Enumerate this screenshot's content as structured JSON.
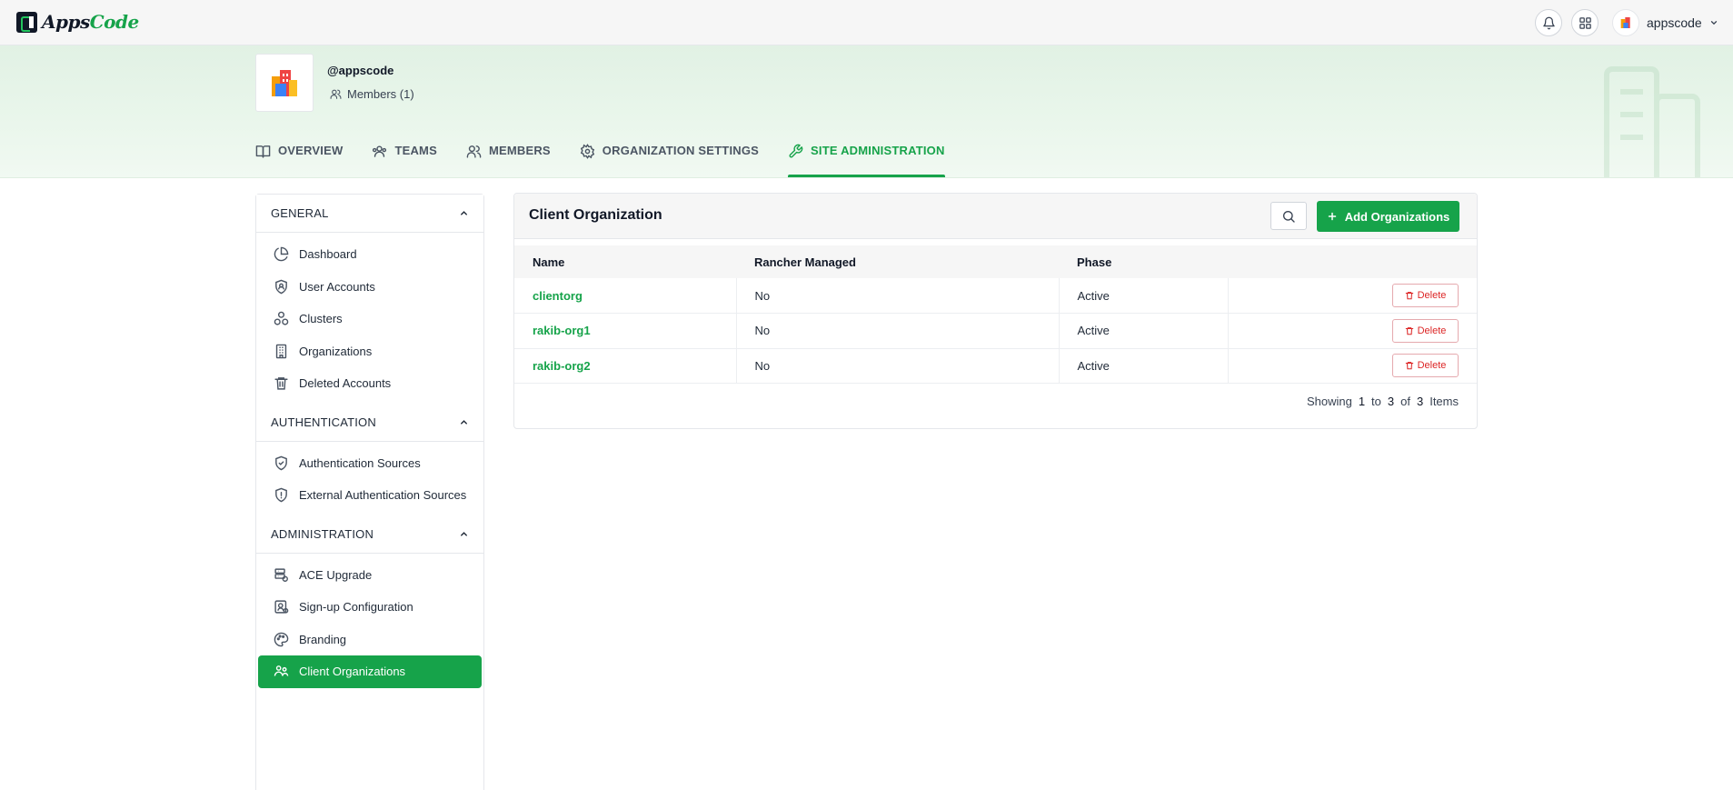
{
  "brand": {
    "name_part1": "Apps",
    "name_part2": "Code",
    "accent": "#16a34a"
  },
  "topbar": {
    "icons": [
      "bell-icon",
      "grid-apps-icon"
    ],
    "username": "appscode"
  },
  "org": {
    "handle": "@appscode",
    "members_label": "Members (1)"
  },
  "tabs": [
    {
      "label": "OVERVIEW",
      "icon": "book-icon",
      "active": false
    },
    {
      "label": "TEAMS",
      "icon": "team-icon",
      "active": false
    },
    {
      "label": "MEMBERS",
      "icon": "members-icon",
      "active": false
    },
    {
      "label": "ORGANIZATION SETTINGS",
      "icon": "gear-icon",
      "active": false
    },
    {
      "label": "SITE ADMINISTRATION",
      "icon": "wrench-icon",
      "active": true
    }
  ],
  "sidebar": {
    "sections": [
      {
        "title": "GENERAL",
        "items": [
          {
            "label": "Dashboard",
            "icon": "pie-chart-icon"
          },
          {
            "label": "User Accounts",
            "icon": "user-shield-icon"
          },
          {
            "label": "Clusters",
            "icon": "clusters-icon"
          },
          {
            "label": "Organizations",
            "icon": "building-icon"
          },
          {
            "label": "Deleted Accounts",
            "icon": "trash-icon"
          }
        ]
      },
      {
        "title": "AUTHENTICATION",
        "items": [
          {
            "label": "Authentication Sources",
            "icon": "shield-check-icon"
          },
          {
            "label": "External Authentication Sources",
            "icon": "shield-alert-icon"
          }
        ]
      },
      {
        "title": "ADMINISTRATION",
        "items": [
          {
            "label": "ACE Upgrade",
            "icon": "server-upgrade-icon"
          },
          {
            "label": "Sign-up Configuration",
            "icon": "signup-config-icon"
          },
          {
            "label": "Branding",
            "icon": "palette-icon"
          },
          {
            "label": "Client Organizations",
            "icon": "client-org-icon",
            "active": true
          }
        ]
      }
    ]
  },
  "main": {
    "title": "Client Organization",
    "add_button": "Add Organizations",
    "columns": [
      "Name",
      "Rancher Managed",
      "Phase",
      ""
    ],
    "rows": [
      {
        "name": "clientorg",
        "rancher_managed": "No",
        "phase": "Active",
        "action": "Delete"
      },
      {
        "name": "rakib-org1",
        "rancher_managed": "No",
        "phase": "Active",
        "action": "Delete"
      },
      {
        "name": "rakib-org2",
        "rancher_managed": "No",
        "phase": "Active",
        "action": "Delete"
      }
    ],
    "pager": {
      "showing": "Showing",
      "from": "1",
      "to_word": "to",
      "to": "3",
      "of_word": "of",
      "total": "3",
      "items": "Items"
    }
  }
}
